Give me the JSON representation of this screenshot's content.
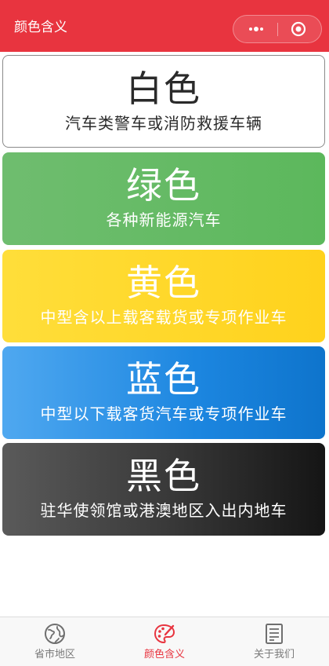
{
  "header": {
    "title": "颜色含义",
    "more_icon": "more-dots-icon",
    "close_icon": "target-close-icon"
  },
  "cards": [
    {
      "title": "白色",
      "description": "汽车类警车或消防救援车辆",
      "color": "#ffffff"
    },
    {
      "title": "绿色",
      "description": "各种新能源汽车",
      "color": "#5cb85c"
    },
    {
      "title": "黄色",
      "description": "中型含以上载客载货或专项作业车",
      "color": "#ffd21c"
    },
    {
      "title": "蓝色",
      "description": "中型以下载客货汽车或专项作业车",
      "color": "#1c86e0"
    },
    {
      "title": "黑色",
      "description": "驻华使领馆或港澳地区入出内地车",
      "color": "#2a2a2a"
    }
  ],
  "tabbar": {
    "tabs": [
      {
        "label": "省市地区",
        "icon": "globe-icon",
        "active": false
      },
      {
        "label": "颜色含义",
        "icon": "palette-icon",
        "active": true
      },
      {
        "label": "关于我们",
        "icon": "document-icon",
        "active": false
      }
    ]
  },
  "colors": {
    "brand": "#e8343f",
    "tab_inactive": "#7a7a7a"
  }
}
